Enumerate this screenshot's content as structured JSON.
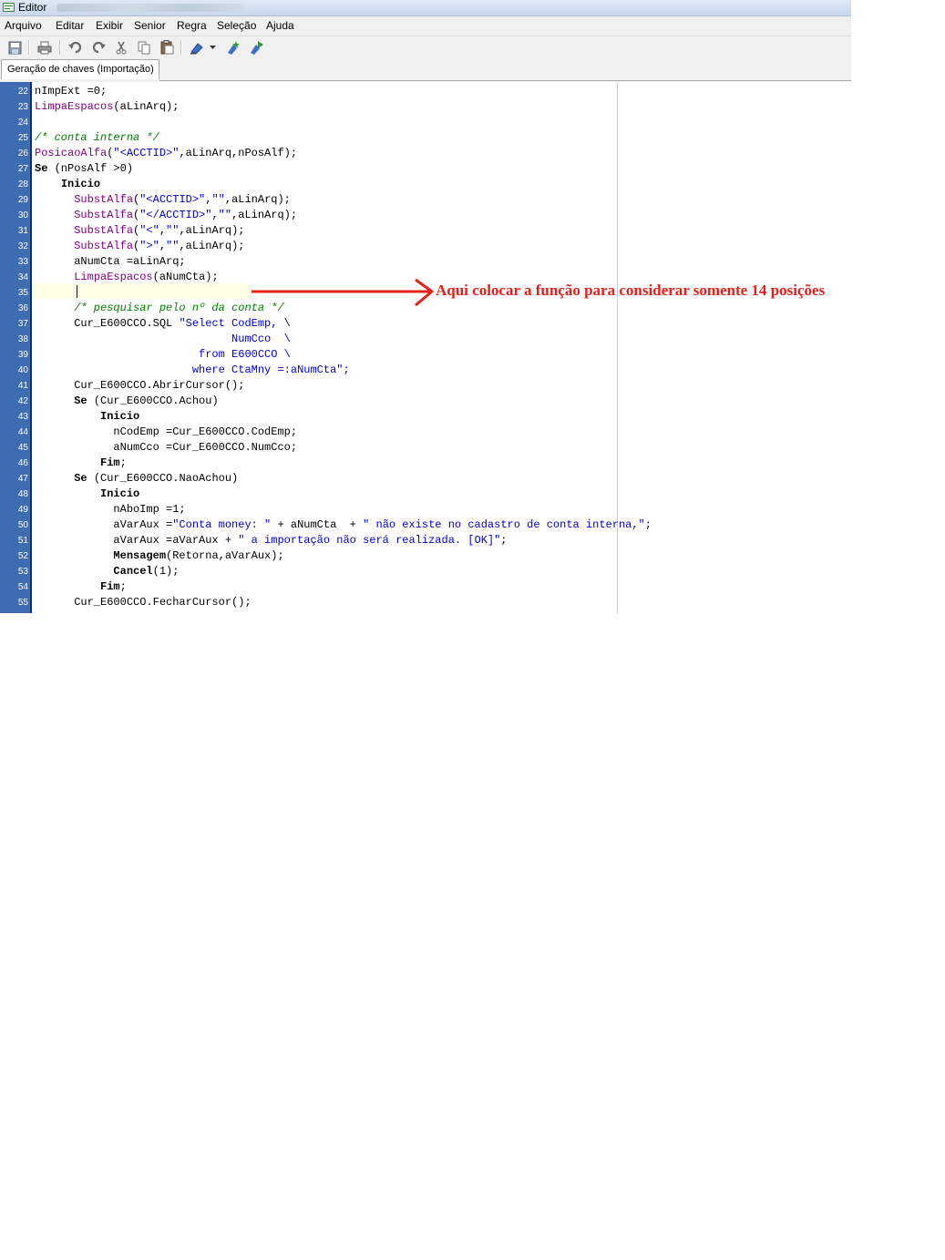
{
  "window": {
    "title": "Editor"
  },
  "menu": [
    "Arquivo",
    "Editar",
    "Exibir",
    "Senior",
    "Regra",
    "Seleção",
    "Ajuda"
  ],
  "toolbar": [
    "save-icon",
    "print-icon",
    "undo-icon",
    "redo-icon",
    "cut-icon",
    "copy-icon",
    "paste-icon",
    "marker-icon",
    "dropdown-icon",
    "compile-icon",
    "run-icon"
  ],
  "tabs": [
    {
      "label": "Geração de chaves (Importação)"
    }
  ],
  "editor": {
    "lines": [
      {
        "n": "22",
        "text": "nImpExt =0;"
      },
      {
        "n": "23",
        "text": "LimpaEspacos(aLinArq);"
      },
      {
        "n": "24",
        "text": ""
      },
      {
        "n": "25",
        "text": "/* conta interna */"
      },
      {
        "n": "26",
        "text": "PosicaoAlfa(\"<ACCTID>\",aLinArq,nPosAlf);"
      },
      {
        "n": "27",
        "text": "Se (nPosAlf >0)"
      },
      {
        "n": "28",
        "text": "    Inicio"
      },
      {
        "n": "29",
        "text": "      SubstAlfa(\"<ACCTID>\",\"\",aLinArq);"
      },
      {
        "n": "30",
        "text": "      SubstAlfa(\"</ACCTID>\",\"\",aLinArq);"
      },
      {
        "n": "31",
        "text": "      SubstAlfa(\"<\",\"\",aLinArq);"
      },
      {
        "n": "32",
        "text": "      SubstAlfa(\">\",\"\",aLinArq);"
      },
      {
        "n": "33",
        "text": "      aNumCta =aLinArq;"
      },
      {
        "n": "34",
        "text": "      LimpaEspacos(aNumCta);"
      },
      {
        "n": "35",
        "text": ""
      },
      {
        "n": "36",
        "text": "      /* pesquisar pelo nº da conta */"
      },
      {
        "n": "37",
        "text": "      Cur_E600CCO.SQL \"Select CodEmp, \\"
      },
      {
        "n": "38",
        "text": "                              NumCco  \\"
      },
      {
        "n": "39",
        "text": "                         from E600CCO \\"
      },
      {
        "n": "40",
        "text": "                        where CtaMny =:aNumCta\";"
      },
      {
        "n": "41",
        "text": "      Cur_E600CCO.AbrirCursor();"
      },
      {
        "n": "42",
        "text": "      Se (Cur_E600CCO.Achou)"
      },
      {
        "n": "43",
        "text": "          Inicio"
      },
      {
        "n": "44",
        "text": "            nCodEmp =Cur_E600CCO.CodEmp;"
      },
      {
        "n": "45",
        "text": "            aNumCco =Cur_E600CCO.NumCco;"
      },
      {
        "n": "46",
        "text": "          Fim;"
      },
      {
        "n": "47",
        "text": "      Se (Cur_E600CCO.NaoAchou)"
      },
      {
        "n": "48",
        "text": "          Inicio"
      },
      {
        "n": "49",
        "text": "            nAboImp =1;"
      },
      {
        "n": "50",
        "text": "            aVarAux =\"Conta money: \" + aNumCta  + \" não existe no cadastro de conta interna,\";"
      },
      {
        "n": "51",
        "text": "            aVarAux =aVarAux + \" a importação não será realizada. [OK]\";"
      },
      {
        "n": "52",
        "text": "            Mensagem(Retorna,aVarAux);"
      },
      {
        "n": "53",
        "text": "            Cancel(1);"
      },
      {
        "n": "54",
        "text": "          Fim;"
      },
      {
        "n": "55",
        "text": "      Cur_E600CCO.FecharCursor();"
      }
    ]
  },
  "annotation": {
    "text": "Aqui colocar a função para considerar somente 14 posições",
    "color": "#e3201a"
  }
}
